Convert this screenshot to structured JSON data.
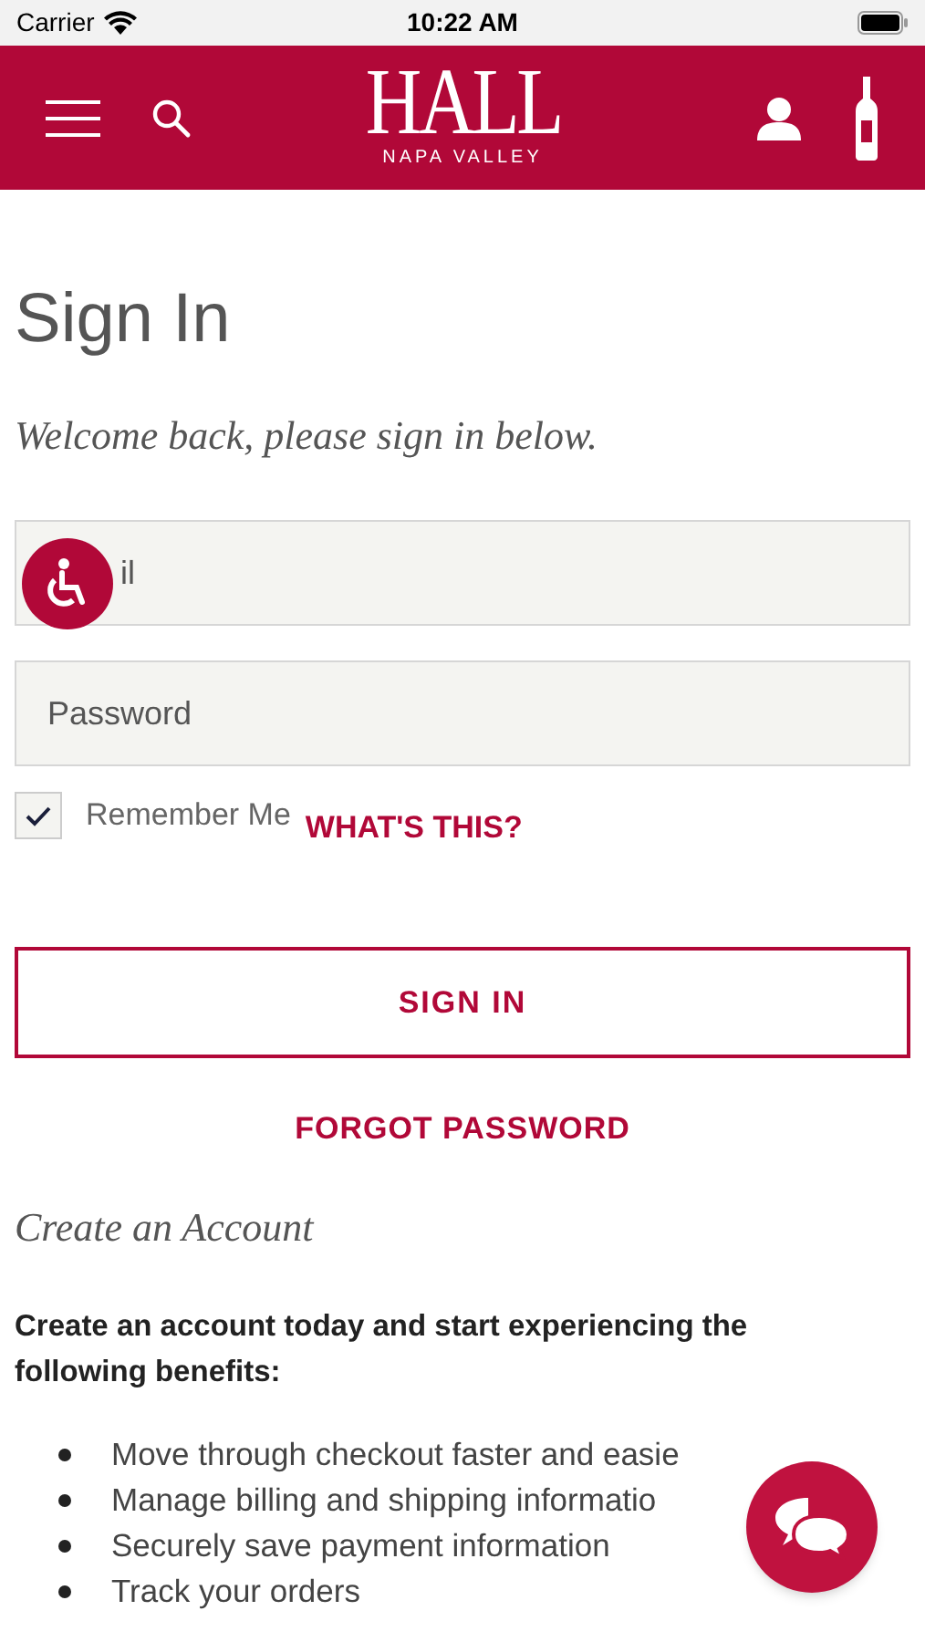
{
  "status_bar": {
    "carrier": "Carrier",
    "time": "10:22 AM"
  },
  "header": {
    "logo": "HALL",
    "logo_subtitle": "NAPA VALLEY"
  },
  "title": "Sign In",
  "subtitle": "Welcome back, please sign in below.",
  "fields": [
    {
      "placeholder": "il",
      "kind": "email"
    },
    {
      "placeholder": "Password",
      "kind": "password"
    }
  ],
  "remember": {
    "label": "Remember Me",
    "checked": true,
    "link": "WHAT'S THIS?"
  },
  "sign_in_button": "SIGN IN",
  "forgot_link": "FORGOT PASSWORD",
  "create_heading": "Create an Account",
  "create_text": "Create an account today and start experiencing the following benefits:",
  "benefits": [
    "Move through checkout faster and easie",
    "Manage billing and shipping informatio",
    "Securely save payment information",
    "Track your orders"
  ]
}
